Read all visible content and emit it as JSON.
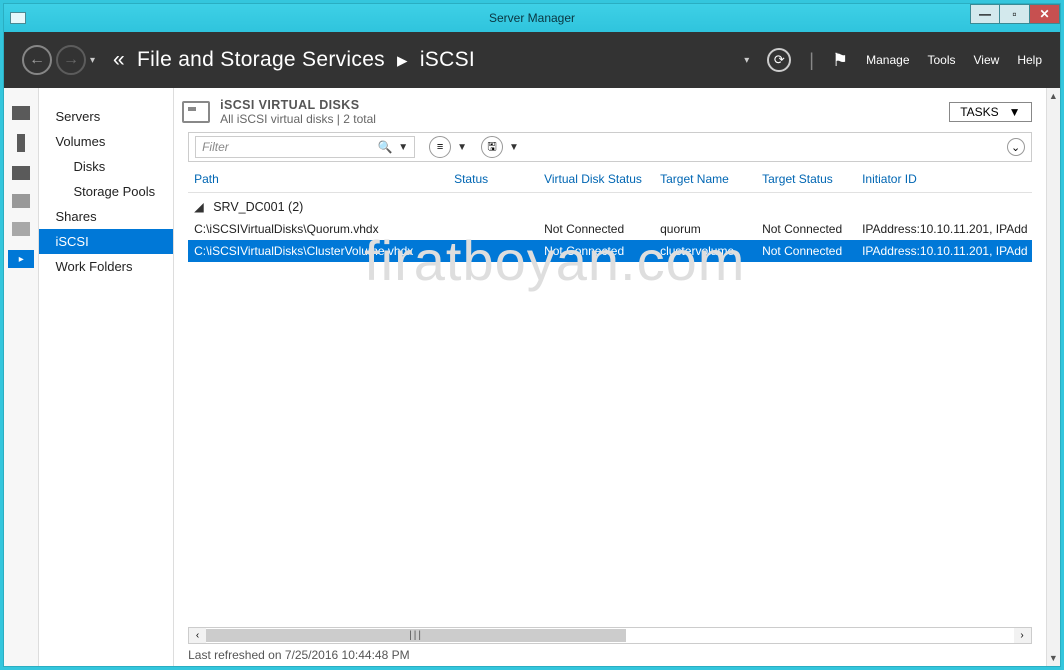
{
  "window": {
    "title": "Server Manager"
  },
  "header": {
    "breadcrumb_back_glyph": "«",
    "breadcrumb_1": "File and Storage Services",
    "breadcrumb_sep": "▸",
    "breadcrumb_2": "iSCSI",
    "menu": {
      "manage": "Manage",
      "tools": "Tools",
      "view": "View",
      "help": "Help"
    }
  },
  "icon_rail": [
    "dash",
    "bar",
    "stack",
    "box",
    "chip"
  ],
  "side_nav": [
    {
      "label": "Servers",
      "level": 0
    },
    {
      "label": "Volumes",
      "level": 0
    },
    {
      "label": "Disks",
      "level": 1
    },
    {
      "label": "Storage Pools",
      "level": 1
    },
    {
      "label": "Shares",
      "level": 0
    },
    {
      "label": "iSCSI",
      "level": 0,
      "selected": true
    },
    {
      "label": "Work Folders",
      "level": 0
    }
  ],
  "panel": {
    "title": "iSCSI VIRTUAL DISKS",
    "subtitle": "All iSCSI virtual disks | 2 total",
    "tasks_label": "TASKS",
    "filter_placeholder": "Filter"
  },
  "columns": {
    "path": "Path",
    "status": "Status",
    "vds": "Virtual Disk Status",
    "target": "Target Name",
    "ts": "Target Status",
    "ini": "Initiator ID"
  },
  "group": {
    "name": "SRV_DC001",
    "count": "(2)"
  },
  "rows": [
    {
      "path": "C:\\iSCSIVirtualDisks\\Quorum.vhdx",
      "status": "",
      "vds": "Not Connected",
      "target": "quorum",
      "ts": "Not Connected",
      "ini": "IPAddress:10.10.11.201, IPAdd",
      "selected": false
    },
    {
      "path": "C:\\iSCSIVirtualDisks\\ClusterVolume.vhdx",
      "status": "",
      "vds": "Not Connected",
      "target": "clustervolume",
      "ts": "Not Connected",
      "ini": "IPAddress:10.10.11.201, IPAdd",
      "selected": true
    }
  ],
  "status_line": "Last refreshed on 7/25/2016 10:44:48 PM",
  "watermark": "firatboyan.com"
}
